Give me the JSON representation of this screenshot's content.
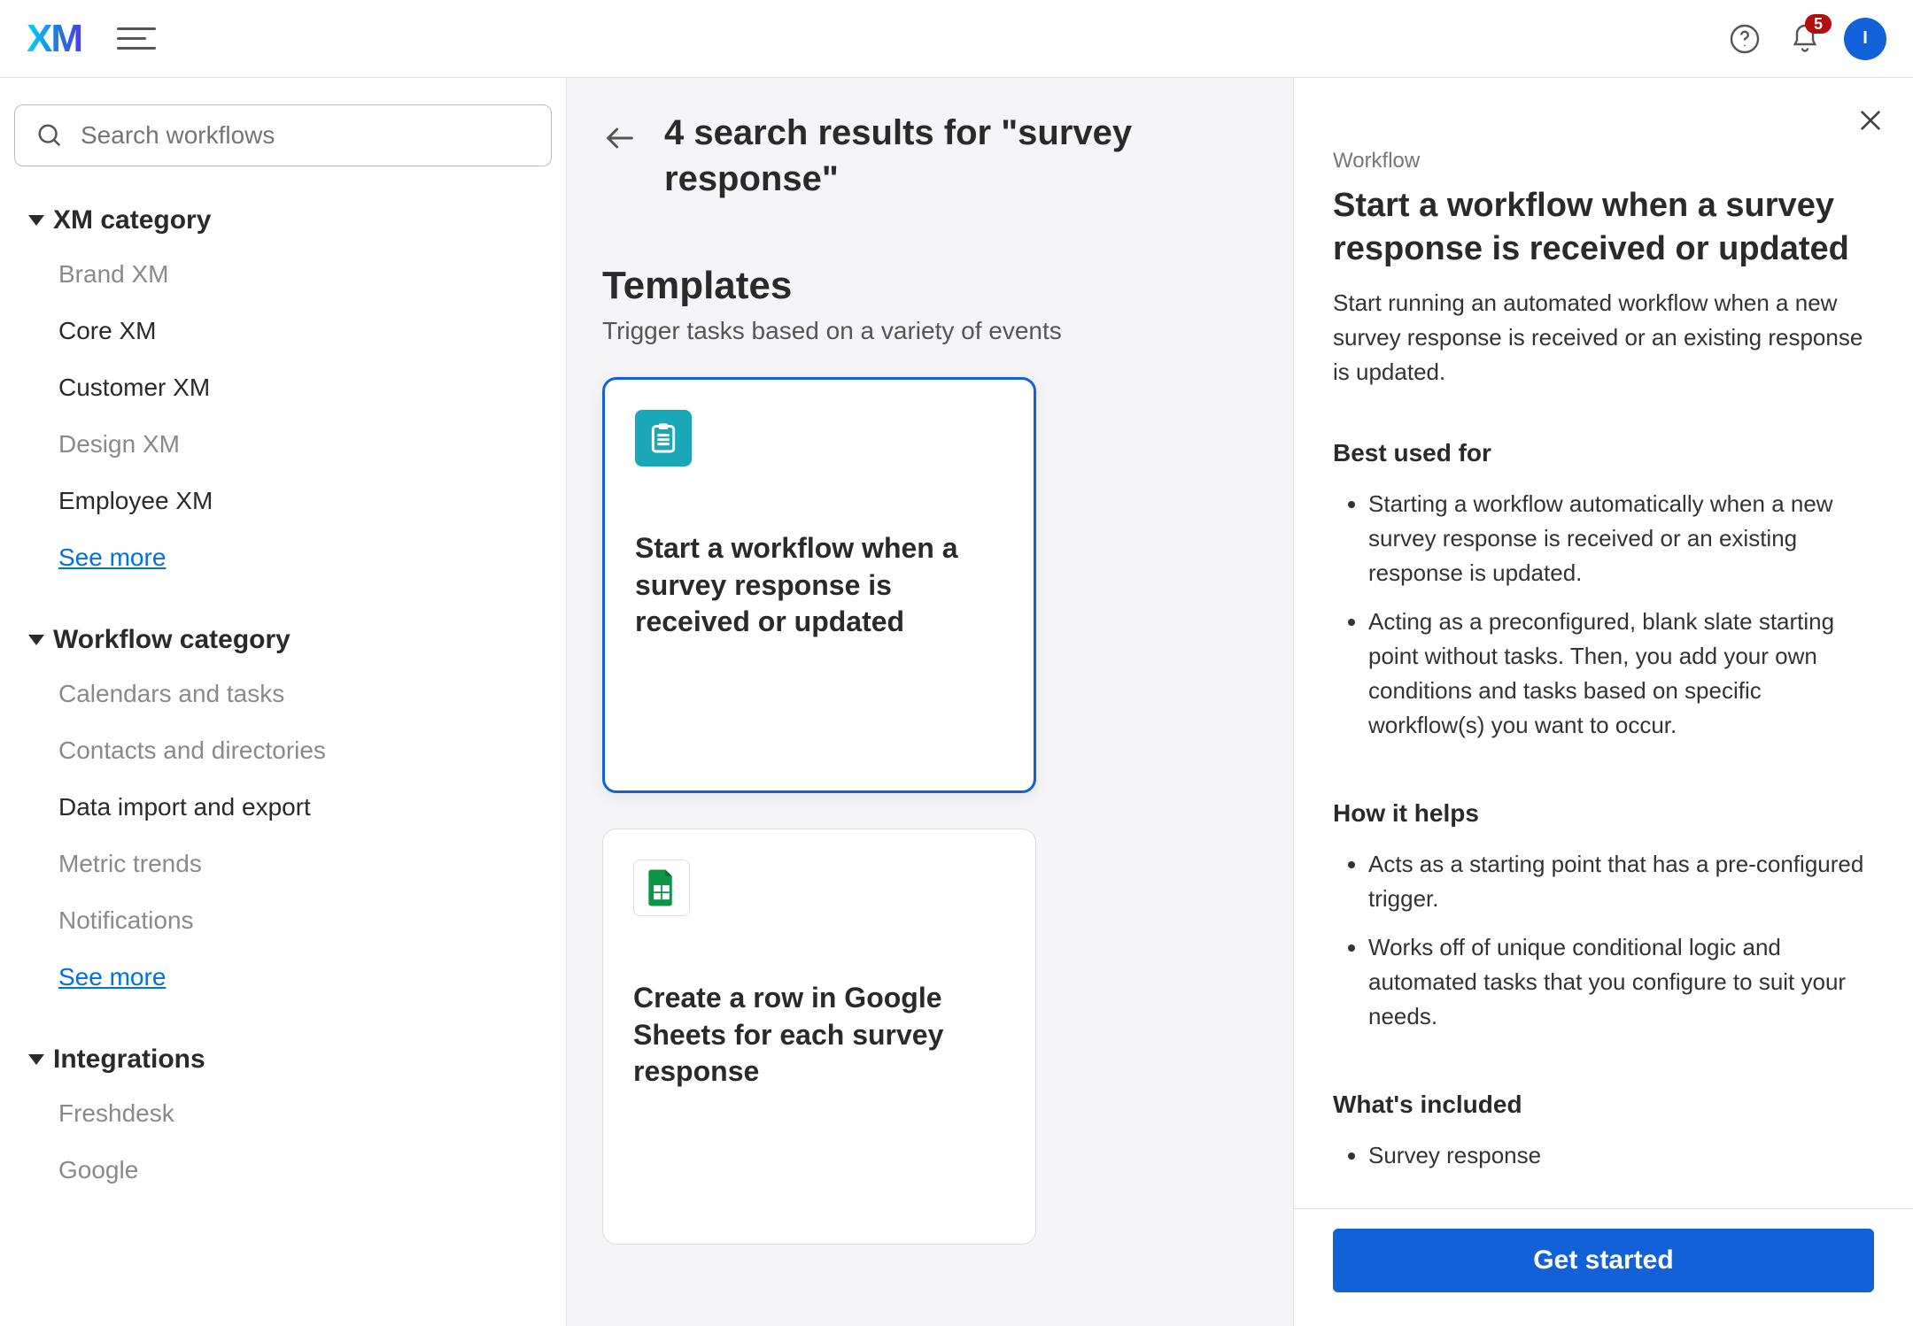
{
  "topnav": {
    "logo_text": "XM",
    "notification_count": "5",
    "avatar_initial": "I"
  },
  "sidebar": {
    "search_placeholder": "Search workflows",
    "sections": [
      {
        "title": "XM category",
        "items": [
          {
            "label": "Brand XM",
            "active": false
          },
          {
            "label": "Core XM",
            "active": true
          },
          {
            "label": "Customer XM",
            "active": true
          },
          {
            "label": "Design XM",
            "active": false
          },
          {
            "label": "Employee XM",
            "active": true
          }
        ],
        "see_more": "See more"
      },
      {
        "title": "Workflow category",
        "items": [
          {
            "label": "Calendars and tasks",
            "active": false
          },
          {
            "label": "Contacts and directories",
            "active": false
          },
          {
            "label": "Data import and export",
            "active": true
          },
          {
            "label": "Metric trends",
            "active": false
          },
          {
            "label": "Notifications",
            "active": false
          }
        ],
        "see_more": "See more"
      },
      {
        "title": "Integrations",
        "items": [
          {
            "label": "Freshdesk",
            "active": false
          },
          {
            "label": "Google",
            "active": false
          }
        ]
      }
    ]
  },
  "results": {
    "heading_prefix": "4 search results for ",
    "heading_quoted": "\"survey response\"",
    "section_title": "Templates",
    "section_subtitle": "Trigger tasks based on a variety of events",
    "cards": [
      {
        "title": "Start a workflow when a survey response is received or updated",
        "icon": "clipboard",
        "selected": true
      },
      {
        "title": "Create a row in Google Sheets for each survey response",
        "icon": "sheet",
        "selected": false
      }
    ]
  },
  "details": {
    "label": "Workflow",
    "title": "Start a workflow when a survey response is received or updated",
    "description": "Start running an automated workflow when a new survey response is received or an existing response is updated.",
    "best_used_title": "Best used for",
    "best_used": [
      "Starting a workflow automatically when a new survey response is received or an existing response is updated.",
      "Acting as a preconfigured, blank slate starting point without tasks. Then, you add your own conditions and tasks based on specific workflow(s) you want to occur."
    ],
    "how_helps_title": "How it helps",
    "how_helps": [
      "Acts as a starting point that has a pre-configured trigger.",
      "Works off of unique conditional logic and automated tasks that you configure to suit your needs."
    ],
    "included_title": "What's included",
    "included": [
      "Survey response"
    ],
    "cta": "Get started"
  }
}
